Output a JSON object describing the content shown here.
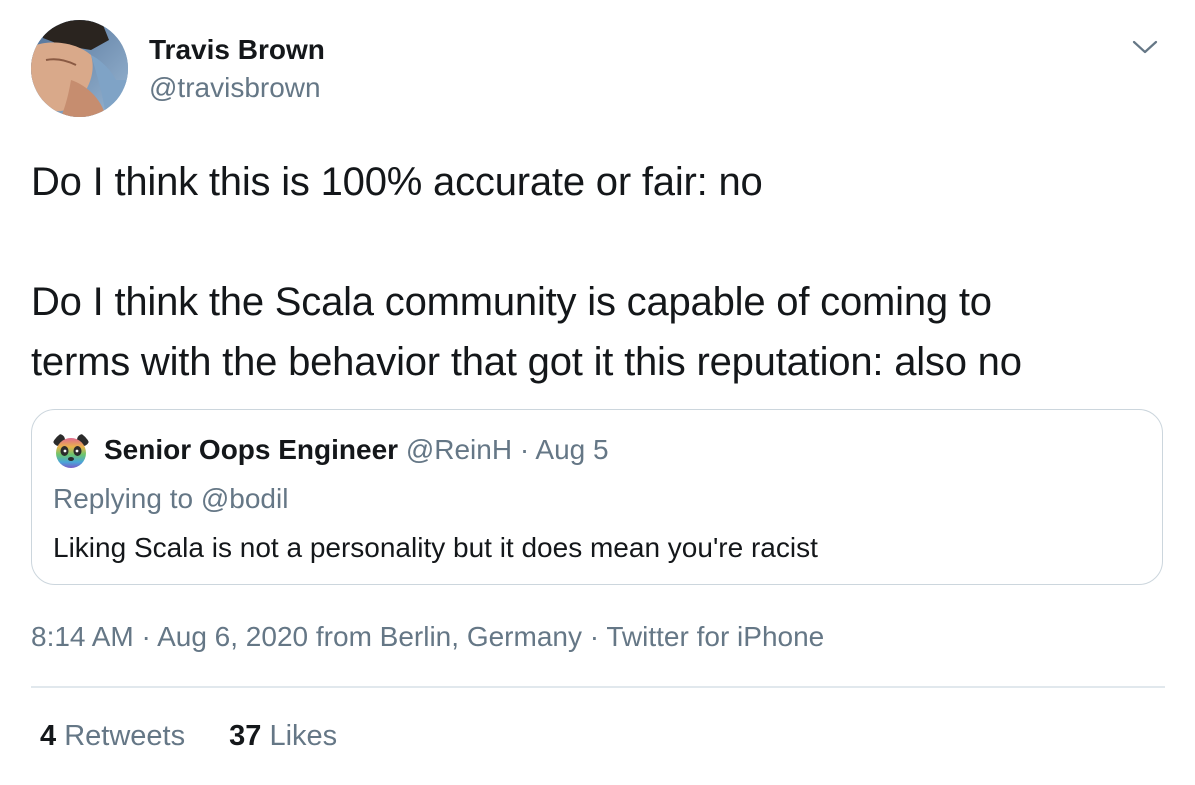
{
  "author": {
    "name": "Travis Brown",
    "handle": "@travisbrown"
  },
  "tweet": {
    "paragraphs": [
      "Do I think this is 100% accurate or fair: no",
      "Do I think the Scala community is capable of coming to",
      "terms with the behavior that got it this reputation: also no"
    ]
  },
  "quoted_tweet": {
    "name": "Senior Oops Engineer",
    "handle": "@ReinH",
    "separator": "·",
    "date": "Aug 5",
    "replying_to": "Replying to @bodil",
    "text": "Liking Scala is not a personality but it does mean you're racist"
  },
  "meta": {
    "time": "8:14 AM",
    "date": "Aug 6, 2020",
    "location": "from Berlin, Germany",
    "source": "Twitter for iPhone",
    "separator": "·"
  },
  "stats": {
    "retweets_count": "4",
    "retweets_label": "Retweets",
    "likes_count": "37",
    "likes_label": "Likes"
  },
  "colors": {
    "text_primary": "#14171a",
    "text_secondary": "#657786",
    "border": "#ccd6dd",
    "divider": "#e1e8ed"
  },
  "icons": {
    "caret": "chevron-down-icon"
  }
}
